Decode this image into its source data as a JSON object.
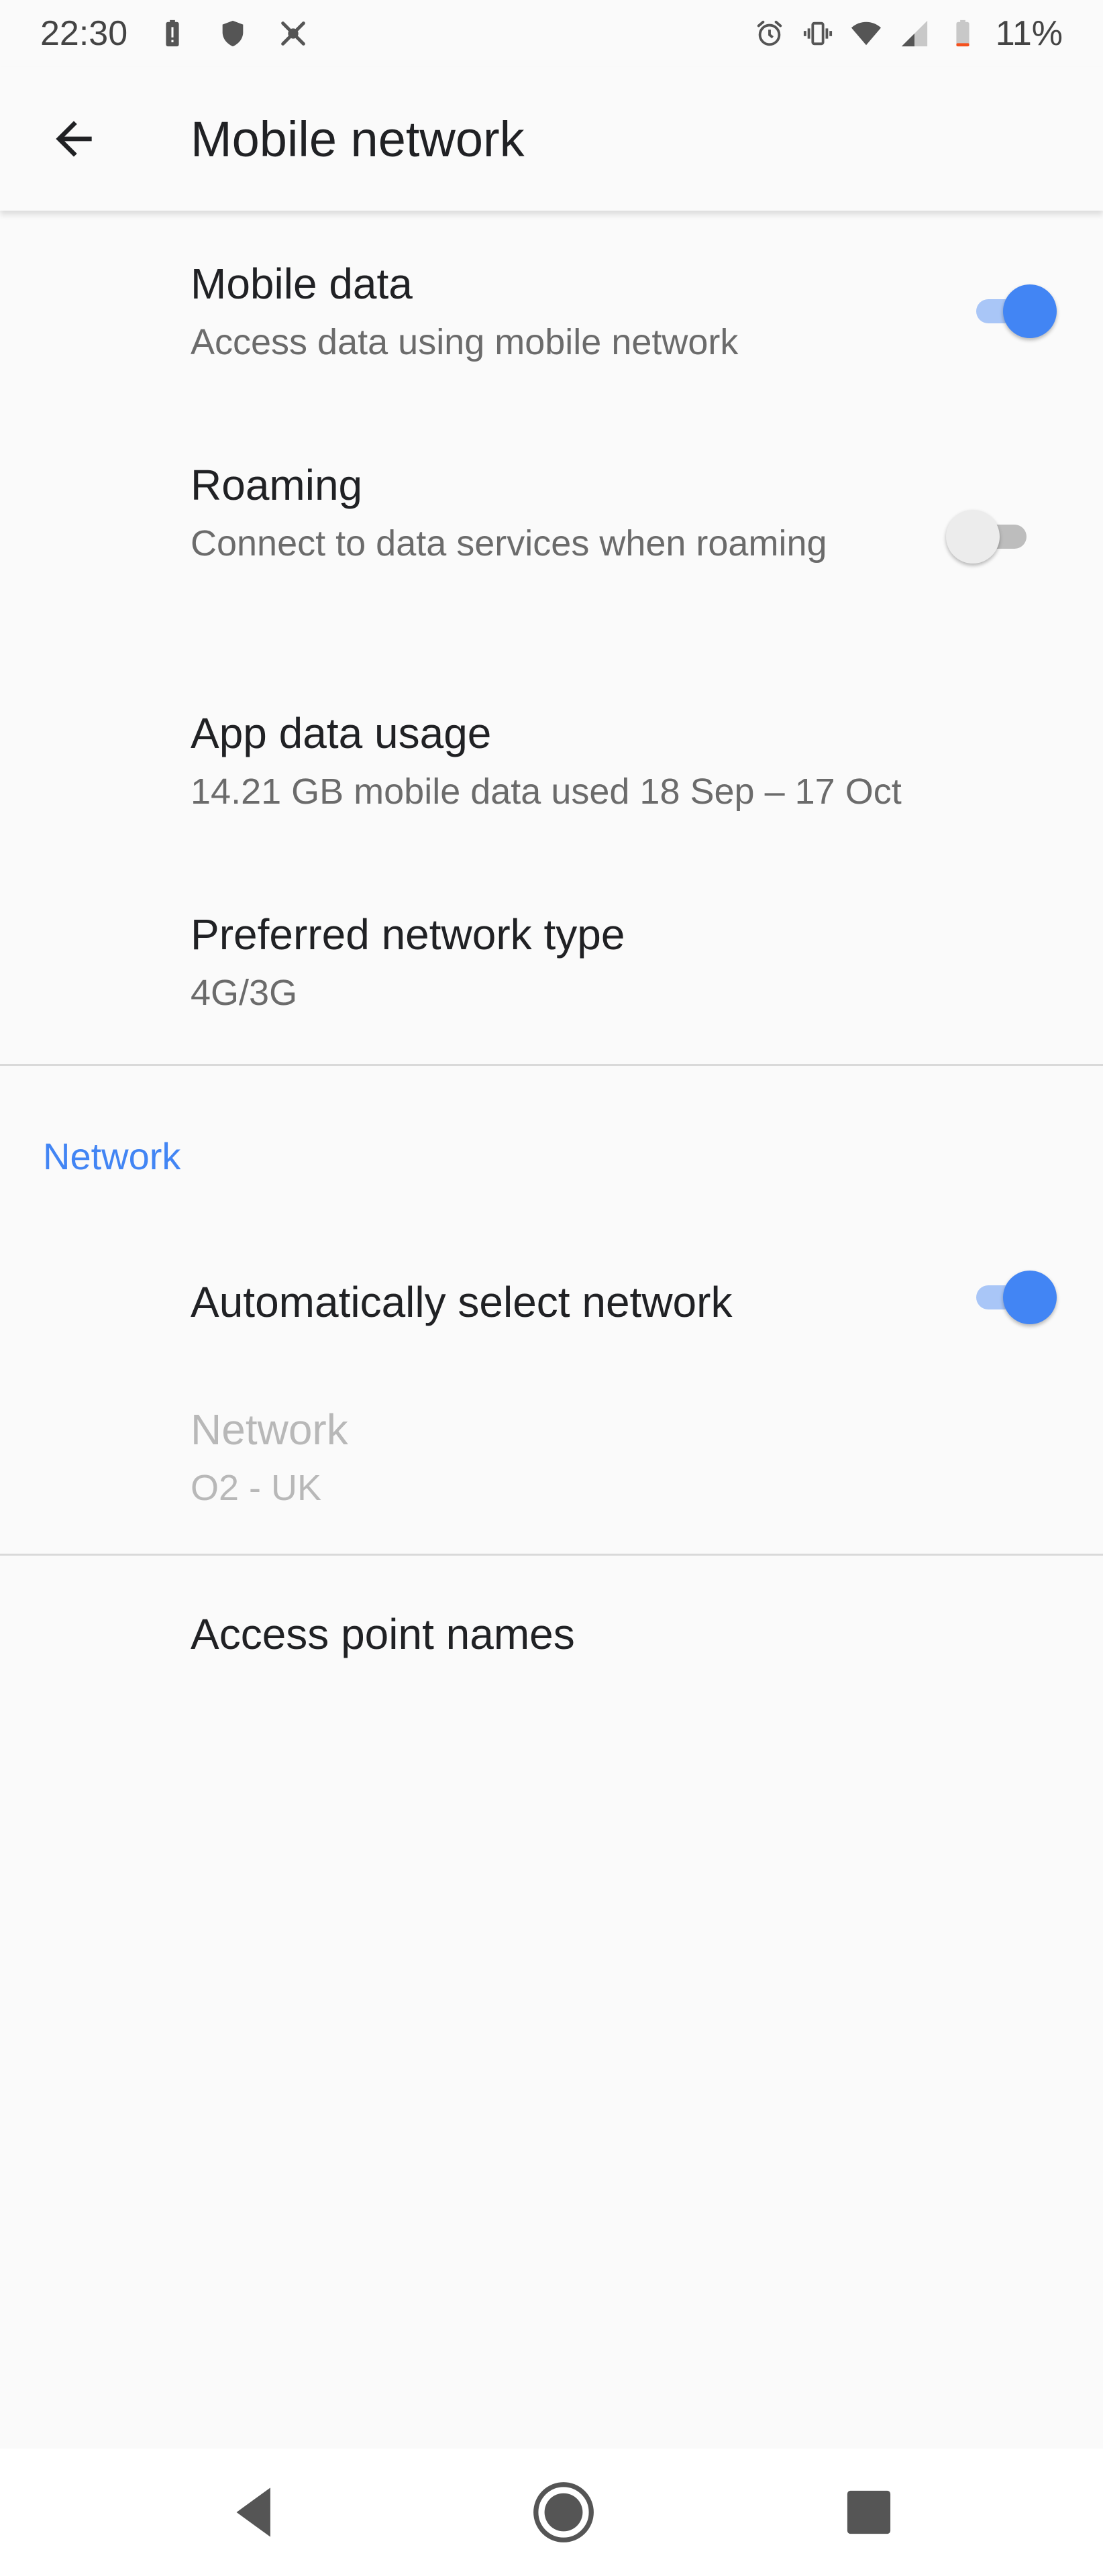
{
  "status_bar": {
    "time": "22:30",
    "battery_percent": "11%",
    "left_icons": [
      "battery-alert-icon",
      "shield-icon",
      "app-notification-icon"
    ],
    "right_icons": [
      "alarm-icon",
      "vibrate-icon",
      "wifi-icon",
      "cell-signal-icon",
      "battery-low-icon"
    ],
    "battery_level": 0.11
  },
  "app_bar": {
    "title": "Mobile network",
    "back_icon": "arrow-back-icon"
  },
  "settings": [
    {
      "title": "Mobile data",
      "summary": "Access data using mobile network",
      "toggle": true
    },
    {
      "title": "Roaming",
      "summary": "Connect to data services when roaming",
      "toggle": false
    },
    {
      "title": "App data usage",
      "summary": "14.21 GB mobile data used 18 Sep – 17 Oct"
    },
    {
      "title": "Preferred network type",
      "summary": "4G/3G"
    }
  ],
  "network_section": {
    "header": "Network",
    "auto_select": {
      "title": "Automatically select network",
      "toggle": true
    },
    "network": {
      "title": "Network",
      "summary": "O2 - UK",
      "enabled": false
    }
  },
  "access_point_names": {
    "title": "Access point names"
  },
  "nav_bar": {
    "icons": [
      "back-triangle-icon",
      "home-circle-icon",
      "recents-square-icon"
    ]
  },
  "colors": {
    "accent": "#4285f4",
    "toggle_track_on": "#a9c6f7",
    "toggle_track_off": "#bdbdbd",
    "disabled_text": "#b8b8b8",
    "background": "#fafafa"
  }
}
